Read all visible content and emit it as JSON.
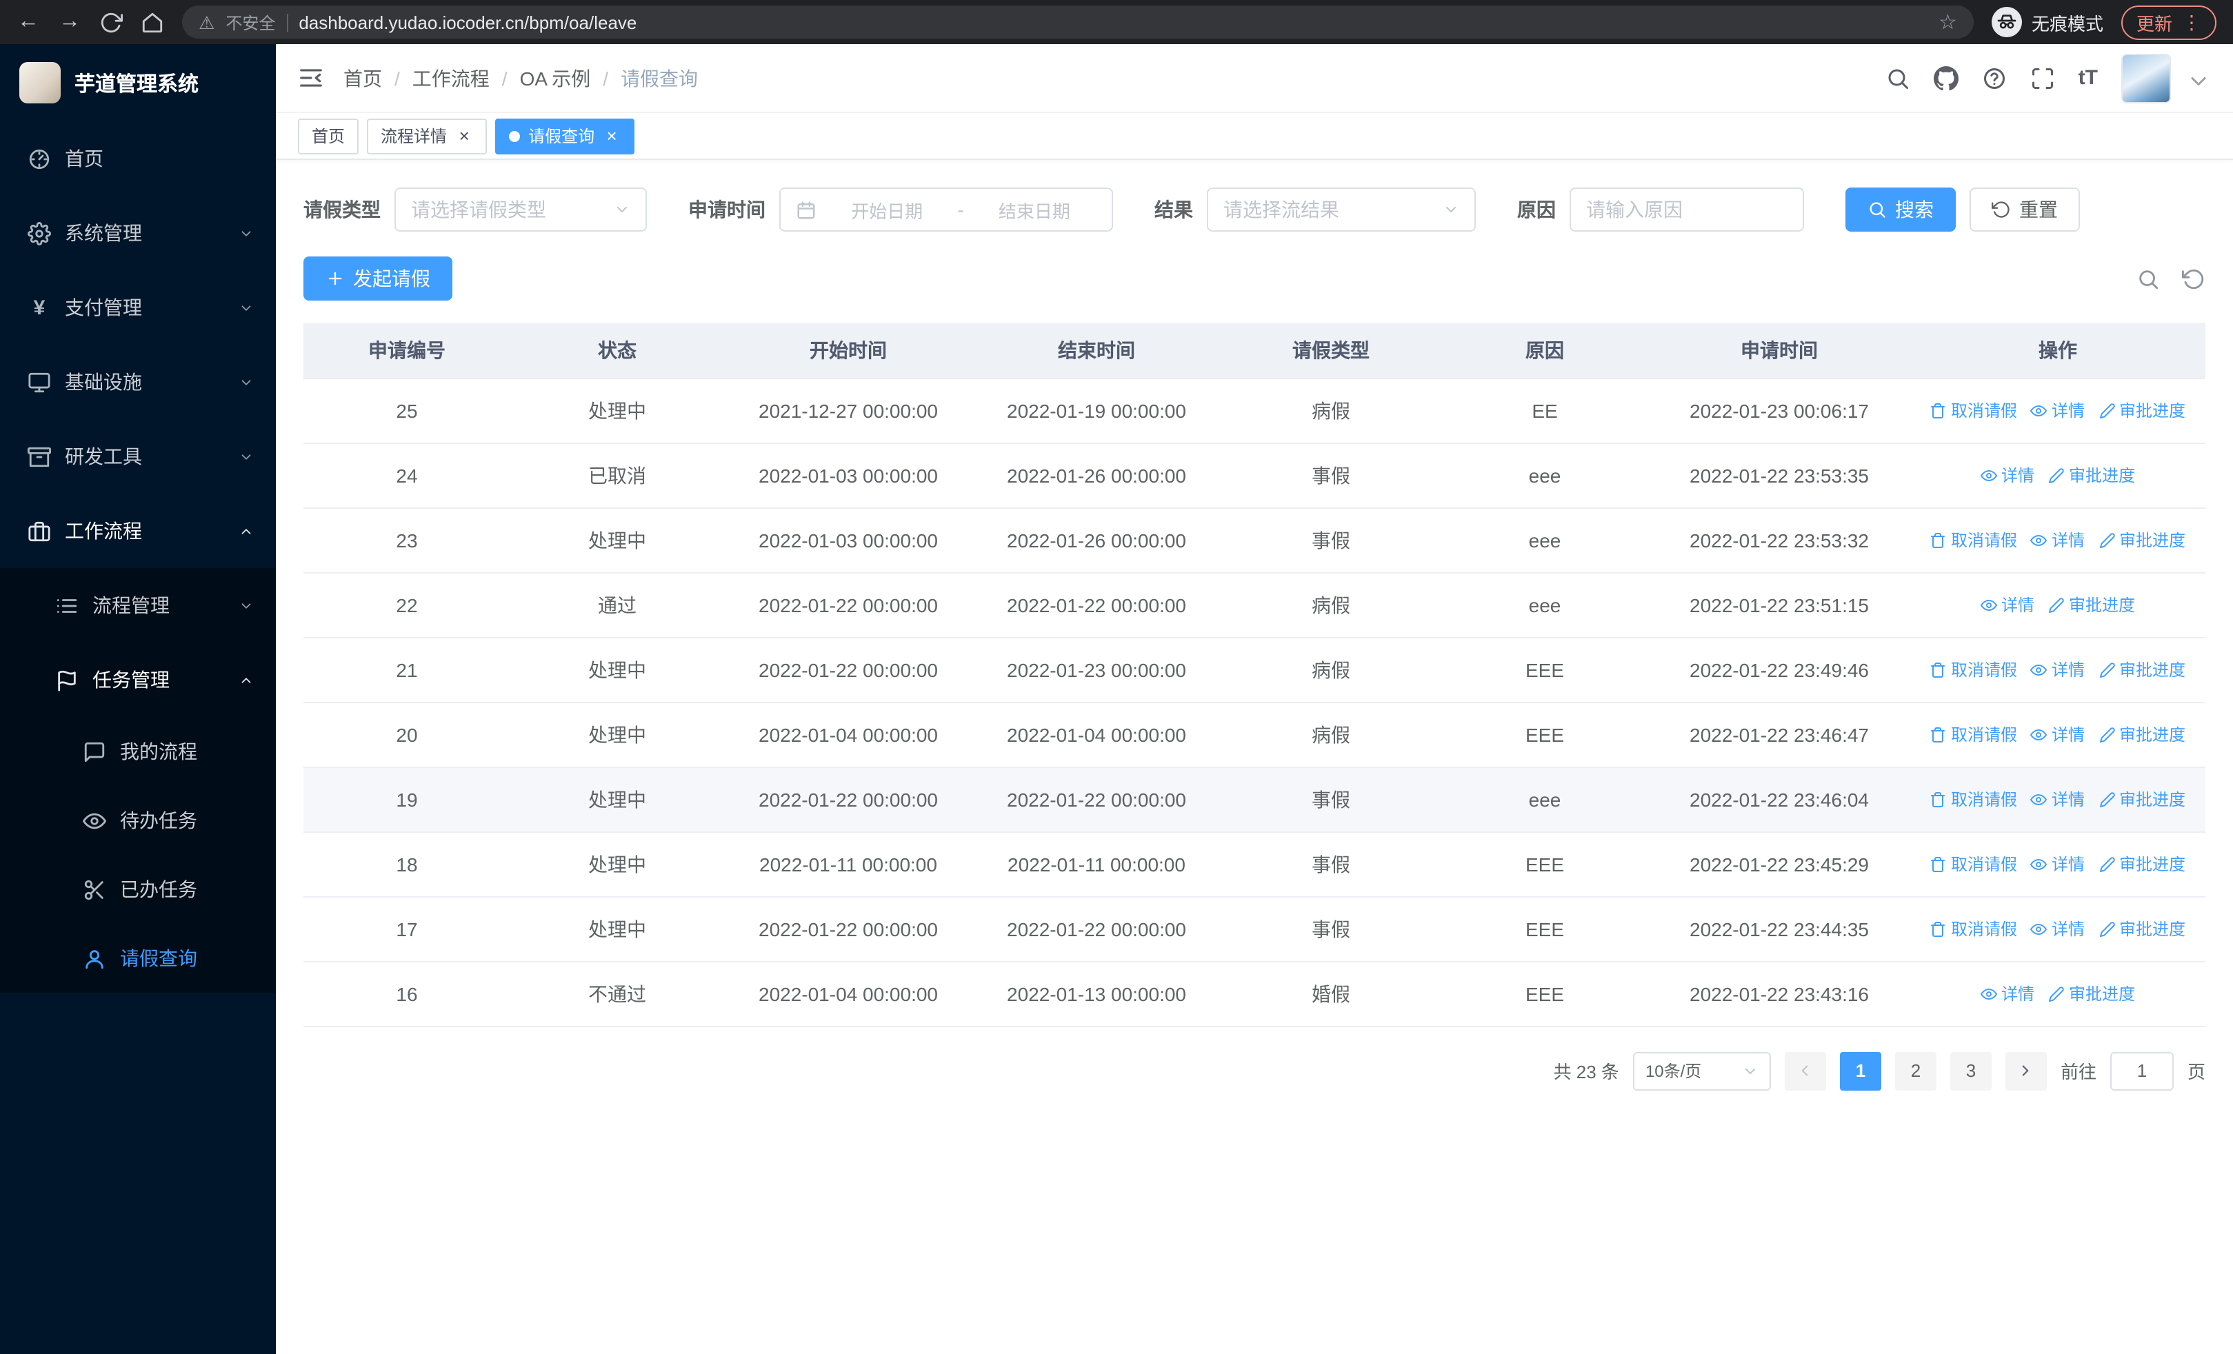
{
  "colors": {
    "accent": "#409eff",
    "sidebar_bg": "#001529",
    "submenu_bg": "#000c17",
    "chrome_bg": "#202124",
    "update_badge": "#f28b82",
    "table_header_bg": "#eef1f6"
  },
  "browser": {
    "security_label": "不安全",
    "url": "dashboard.yudao.iocoder.cn/bpm/oa/leave",
    "incognito_label": "无痕模式",
    "update_label": "更新",
    "nav_icons": [
      "back-icon",
      "forward-icon",
      "reload-icon",
      "home-chrome-icon",
      "warning-icon",
      "star-icon",
      "incognito-icon",
      "dots-icon"
    ]
  },
  "sidebar": {
    "app_title": "芋道管理系统",
    "items": [
      {
        "label": "首页",
        "icon": "dashboard-icon",
        "level": 1
      },
      {
        "label": "系统管理",
        "icon": "gear-icon",
        "level": 1,
        "chevron": "down"
      },
      {
        "label": "支付管理",
        "icon": "yen-icon",
        "level": 1,
        "chevron": "down"
      },
      {
        "label": "基础设施",
        "icon": "infra-icon",
        "level": 1,
        "chevron": "down"
      },
      {
        "label": "研发工具",
        "icon": "toolbox-icon",
        "level": 1,
        "chevron": "down"
      },
      {
        "label": "工作流程",
        "icon": "briefcase-icon",
        "level": 1,
        "chevron": "up",
        "open": true
      },
      {
        "label": "流程管理",
        "icon": "list-icon",
        "level": 2,
        "chevron": "down",
        "submenu": true
      },
      {
        "label": "任务管理",
        "icon": "flag-icon",
        "level": 2,
        "chevron": "up",
        "open": true,
        "submenu": true
      },
      {
        "label": "我的流程",
        "icon": "chat-icon",
        "level": 3,
        "submenu": true
      },
      {
        "label": "待办任务",
        "icon": "eye-icon",
        "level": 3,
        "submenu": true
      },
      {
        "label": "已办任务",
        "icon": "scissors-icon",
        "level": 3,
        "submenu": true
      },
      {
        "label": "请假查询",
        "icon": "user-icon",
        "level": 3,
        "submenu": true,
        "active": true
      }
    ]
  },
  "header": {
    "breadcrumb": [
      "首页",
      "工作流程",
      "OA 示例",
      "请假查询"
    ],
    "separator": "/",
    "action_icons": [
      "search-icon",
      "github-icon",
      "help-icon",
      "fullscreen-icon",
      "font-size-icon"
    ]
  },
  "tabs": [
    {
      "label": "首页",
      "closable": false,
      "active": false
    },
    {
      "label": "流程详情",
      "closable": true,
      "active": false
    },
    {
      "label": "请假查询",
      "closable": true,
      "active": true
    }
  ],
  "filters": {
    "leave_type_label": "请假类型",
    "leave_type_placeholder": "请选择请假类型",
    "apply_time_label": "申请时间",
    "start_date_placeholder": "开始日期",
    "range_separator": "-",
    "end_date_placeholder": "结束日期",
    "result_label": "结果",
    "result_placeholder": "请选择流结果",
    "reason_label": "原因",
    "reason_placeholder": "请输入原因",
    "search_label": "搜索",
    "reset_label": "重置"
  },
  "toolbar": {
    "create_label": "发起请假"
  },
  "table": {
    "columns": [
      "申请编号",
      "状态",
      "开始时间",
      "结束时间",
      "请假类型",
      "原因",
      "申请时间",
      "操作"
    ],
    "action_labels": {
      "cancel": "取消请假",
      "detail": "详情",
      "progress": "审批进度"
    },
    "rows": [
      {
        "id": "25",
        "status": "处理中",
        "start": "2021-12-27 00:00:00",
        "end": "2022-01-19 00:00:00",
        "type": "病假",
        "reason": "EE",
        "applied": "2022-01-23 00:06:17",
        "actions": [
          "cancel",
          "detail",
          "progress"
        ]
      },
      {
        "id": "24",
        "status": "已取消",
        "start": "2022-01-03 00:00:00",
        "end": "2022-01-26 00:00:00",
        "type": "事假",
        "reason": "eee",
        "applied": "2022-01-22 23:53:35",
        "actions": [
          "detail",
          "progress"
        ]
      },
      {
        "id": "23",
        "status": "处理中",
        "start": "2022-01-03 00:00:00",
        "end": "2022-01-26 00:00:00",
        "type": "事假",
        "reason": "eee",
        "applied": "2022-01-22 23:53:32",
        "actions": [
          "cancel",
          "detail",
          "progress"
        ]
      },
      {
        "id": "22",
        "status": "通过",
        "start": "2022-01-22 00:00:00",
        "end": "2022-01-22 00:00:00",
        "type": "病假",
        "reason": "eee",
        "applied": "2022-01-22 23:51:15",
        "actions": [
          "detail",
          "progress"
        ]
      },
      {
        "id": "21",
        "status": "处理中",
        "start": "2022-01-22 00:00:00",
        "end": "2022-01-23 00:00:00",
        "type": "病假",
        "reason": "EEE",
        "applied": "2022-01-22 23:49:46",
        "actions": [
          "cancel",
          "detail",
          "progress"
        ]
      },
      {
        "id": "20",
        "status": "处理中",
        "start": "2022-01-04 00:00:00",
        "end": "2022-01-04 00:00:00",
        "type": "病假",
        "reason": "EEE",
        "applied": "2022-01-22 23:46:47",
        "actions": [
          "cancel",
          "detail",
          "progress"
        ]
      },
      {
        "id": "19",
        "status": "处理中",
        "start": "2022-01-22 00:00:00",
        "end": "2022-01-22 00:00:00",
        "type": "事假",
        "reason": "eee",
        "applied": "2022-01-22 23:46:04",
        "actions": [
          "cancel",
          "detail",
          "progress"
        ],
        "highlight": true
      },
      {
        "id": "18",
        "status": "处理中",
        "start": "2022-01-11 00:00:00",
        "end": "2022-01-11 00:00:00",
        "type": "事假",
        "reason": "EEE",
        "applied": "2022-01-22 23:45:29",
        "actions": [
          "cancel",
          "detail",
          "progress"
        ]
      },
      {
        "id": "17",
        "status": "处理中",
        "start": "2022-01-22 00:00:00",
        "end": "2022-01-22 00:00:00",
        "type": "事假",
        "reason": "EEE",
        "applied": "2022-01-22 23:44:35",
        "actions": [
          "cancel",
          "detail",
          "progress"
        ]
      },
      {
        "id": "16",
        "status": "不通过",
        "start": "2022-01-04 00:00:00",
        "end": "2022-01-13 00:00:00",
        "type": "婚假",
        "reason": "EEE",
        "applied": "2022-01-22 23:43:16",
        "actions": [
          "detail",
          "progress"
        ]
      }
    ]
  },
  "pagination": {
    "total_label": "共 23 条",
    "page_size_value": "10条/页",
    "pages": [
      "1",
      "2",
      "3"
    ],
    "active_page": "1",
    "goto_label": "前往",
    "goto_value": "1",
    "page_unit": "页"
  }
}
